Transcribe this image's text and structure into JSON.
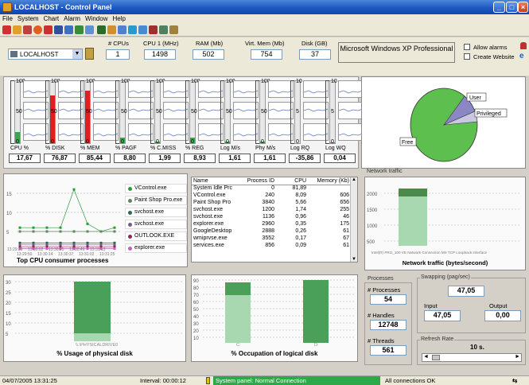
{
  "window": {
    "title": "LOCALHOST - Control Panel",
    "app_badge": "VCW"
  },
  "menu": [
    "File",
    "System",
    "Chart",
    "Alarm",
    "Window",
    "Help"
  ],
  "host": {
    "selected": "LOCALHOST"
  },
  "info": {
    "cpus_label": "# CPUs",
    "cpus": "1",
    "cpu_mhz_label": "CPU 1 (MHz)",
    "cpu_mhz": "1498",
    "ram_label": "RAM (Mb)",
    "ram": "502",
    "virt_label": "Virt. Mem (Mb)",
    "virt": "754",
    "disk_label": "Disk (GB)",
    "disk": "37",
    "os": "Microsoft Windows XP Professional"
  },
  "options": {
    "allow_alarms": "Allow alarms",
    "create_website": "Create Website"
  },
  "gauges": [
    {
      "label": "CPU %",
      "value": "17,67",
      "top": "100",
      "mid": "50",
      "bot": "0",
      "fill": 0.18,
      "color": "#3aa84a"
    },
    {
      "label": "% DISK",
      "value": "76,87",
      "top": "100",
      "mid": "50",
      "bot": "0",
      "fill": 0.77,
      "color": "#e02020"
    },
    {
      "label": "% MEM",
      "value": "85,44",
      "top": "100",
      "mid": "50",
      "bot": "0",
      "fill": 0.85,
      "color": "#e02020"
    },
    {
      "label": "% PAGF",
      "value": "8,80",
      "top": "100",
      "mid": "50",
      "bot": "0",
      "fill": 0.09,
      "color": "#3aa84a"
    },
    {
      "label": "% C.MISS",
      "value": "1,99",
      "top": "100",
      "mid": "50",
      "bot": "0",
      "fill": 0.02,
      "color": "#3aa84a"
    },
    {
      "label": "% REG",
      "value": "8,93",
      "top": "100",
      "mid": "50",
      "bot": "0",
      "fill": 0.09,
      "color": "#3aa84a"
    },
    {
      "label": "Log M/s",
      "value": "1,61",
      "top": "100",
      "mid": "50",
      "bot": "0",
      "fill": 0.02,
      "color": "#3aa84a"
    },
    {
      "label": "Phy M/s",
      "value": "1,61",
      "top": "100",
      "mid": "50",
      "bot": "0",
      "fill": 0.02,
      "color": "#3aa84a"
    },
    {
      "label": "Log RQ",
      "value": "-35,86",
      "top": "10",
      "mid": "5",
      "bot": "0",
      "fill": 0,
      "color": "#3aa84a"
    },
    {
      "label": "Log WQ",
      "value": "0,04",
      "top": "10",
      "mid": "5",
      "bot": "0",
      "fill": 0.01,
      "color": "#3aa84a"
    }
  ],
  "pie": {
    "labels": {
      "user": "User",
      "privileged": "Privileged",
      "free": "Free"
    }
  },
  "top_cpu": {
    "title": "Top CPU consumer processes",
    "yticks": [
      "15",
      "10",
      "5"
    ],
    "xticks": [
      "13:29:39",
      "13:30:02",
      "13:30:25",
      "13:30:49",
      "13:31:13"
    ],
    "xticks2": [
      "13:29:50",
      "13:30:14",
      "13:30:37",
      "13:31:02",
      "13:31:25"
    ],
    "legend": [
      {
        "name": "VControl.exe",
        "color": "#2a9a3a"
      },
      {
        "name": "Paint Shop Pro.exe",
        "color": "#5a8a5a"
      },
      {
        "name": "svchost.exe",
        "color": "#2a6a4a"
      },
      {
        "name": "svchost.exe",
        "color": "#7a5a8a"
      },
      {
        "name": "OUTLOOK.EXE",
        "color": "#8a2a5a"
      },
      {
        "name": "explorer.exe",
        "color": "#c060c0"
      }
    ]
  },
  "processes": {
    "headers": [
      "Name",
      "Process ID",
      "CPU",
      "Memory (Kb)"
    ],
    "rows": [
      [
        "System Idle Prc",
        "0",
        "81,89",
        ""
      ],
      [
        "VControl.exe",
        "240",
        "8,09",
        "606"
      ],
      [
        "Paint Shop Pro",
        "3840",
        "5,66",
        "656"
      ],
      [
        "svchost.exe",
        "1200",
        "1,74",
        "255"
      ],
      [
        "svchost.exe",
        "1136",
        "0,96",
        "46"
      ],
      [
        "explorer.exe",
        "2960",
        "0,35",
        "175"
      ],
      [
        "GoogleDesktop",
        "2888",
        "0,26",
        "61"
      ],
      [
        "wmiprvse.exe",
        "3552",
        "0,17",
        "67"
      ],
      [
        "services.exe",
        "856",
        "0,09",
        "61"
      ]
    ]
  },
  "network": {
    "section": "Network traffic",
    "title": "Network traffic (bytes/second)",
    "yticks": [
      "2000",
      "1500",
      "1000",
      "500"
    ],
    "iface": "Intel(R) PRO_100 VE Network Connection MS TCP Loopback interface"
  },
  "phys_disk": {
    "title": "% Usage of physical disk",
    "yticks": [
      "30",
      "25",
      "20",
      "15",
      "10",
      "5"
    ],
    "xlabel": "\\\\.\\PHYSICALDRIVE0"
  },
  "logical_disk": {
    "title": "% Occupation of logical disk",
    "yticks": [
      "90",
      "80",
      "70",
      "60",
      "50",
      "40",
      "30",
      "20",
      "10"
    ],
    "xlabels": [
      "C:",
      "D:"
    ]
  },
  "stats": {
    "processes_section": "Processes",
    "processes_label": "# Processes",
    "processes": "54",
    "handles_label": "# Handles",
    "handles": "12748",
    "threads_label": "# Threads",
    "threads": "561"
  },
  "swapping": {
    "section": "Swapping (pag/sec)",
    "total": "47,05",
    "input_label": "Input",
    "input": "47,05",
    "output_label": "Output",
    "output": "0,00"
  },
  "refresh": {
    "section": "Refresh Rate",
    "value": "10 s."
  },
  "status": {
    "datetime": "04/07/2005 13:31:25",
    "interval": "Interval: 00:00:12",
    "panel": "System panel: Normal Connection",
    "connections": "All connections OK"
  }
}
